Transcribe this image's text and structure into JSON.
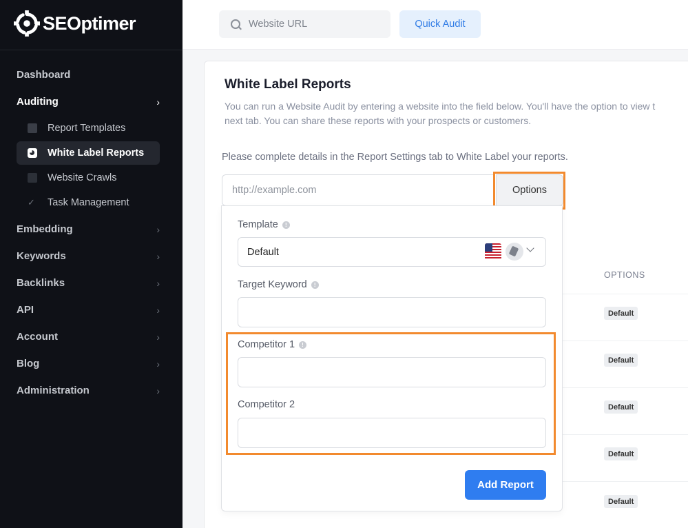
{
  "app": {
    "name": "SEOptimer"
  },
  "sidebar": {
    "items": [
      {
        "label": "Dashboard"
      },
      {
        "label": "Auditing"
      },
      {
        "label": "Embedding"
      },
      {
        "label": "Keywords"
      },
      {
        "label": "Backlinks"
      },
      {
        "label": "API"
      },
      {
        "label": "Account"
      },
      {
        "label": "Blog"
      },
      {
        "label": "Administration"
      }
    ],
    "auditing_sub": [
      {
        "label": "Report Templates"
      },
      {
        "label": "White Label Reports"
      },
      {
        "label": "Website Crawls"
      },
      {
        "label": "Task Management"
      }
    ]
  },
  "topbar": {
    "search_placeholder": "Website URL",
    "quick_audit_label": "Quick Audit"
  },
  "main": {
    "title": "White Label Reports",
    "description": "You can run a Website Audit by entering a website into the field below. You'll have the option to view t\nnext tab. You can share these reports with your prospects or customers.",
    "notice": "Please complete details in the Report Settings tab to White Label your reports.",
    "url_placeholder": "http://example.com",
    "options_label": "Options"
  },
  "table": {
    "options_header": "OPTIONS",
    "badges": [
      "Default",
      "Default",
      "Default",
      "Default",
      "Default"
    ]
  },
  "panel": {
    "template_label": "Template",
    "template_value": "Default",
    "target_keyword_label": "Target Keyword",
    "competitor1_label": "Competitor 1",
    "competitor2_label": "Competitor 2",
    "add_report_label": "Add Report"
  },
  "colors": {
    "sidebar_bg": "#0f1117",
    "accent_blue": "#2f7df0",
    "highlight_orange": "#f28a2e"
  }
}
